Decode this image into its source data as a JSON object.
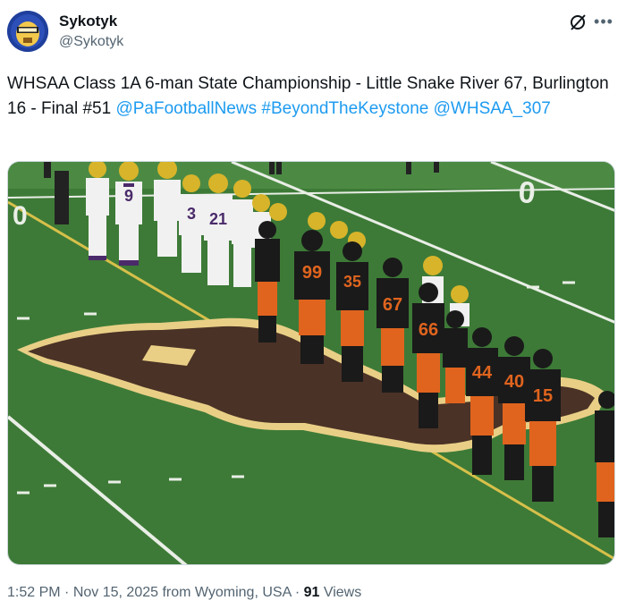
{
  "author": {
    "name": "Sykotyk",
    "handle": "@Sykotyk"
  },
  "post": {
    "text_plain": "WHSAA Class 1A 6-man State Championship - Little Snake River 67, Burlington 16 - Final #51 ",
    "mentions": [
      "@PaFootballNews",
      "#BeyondTheKeystone",
      "@WHSAA_307"
    ]
  },
  "photo": {
    "subject": "football players shaking hands on field",
    "jersey_numbers_purple": [
      "9",
      "3",
      "21"
    ],
    "jersey_numbers_black": [
      "99",
      "35",
      "67",
      "66",
      "44",
      "40",
      "15"
    ],
    "colors": {
      "field": "#3f7a3a",
      "logo_brown": "#4a3226",
      "logo_outline": "#e9cf86",
      "black_jersey": "#1a1a1a",
      "orange_pants": "#e0641e",
      "white_jersey": "#f1f1f1",
      "gold_helmet": "#d8b42a"
    }
  },
  "meta": {
    "time": "1:52 PM",
    "date": "Nov 15, 2025",
    "location": "from Wyoming, USA",
    "separator": "·",
    "views_count": "91",
    "views_label": "Views"
  },
  "icons": [
    "avatar",
    "grok-icon",
    "more-icon"
  ]
}
